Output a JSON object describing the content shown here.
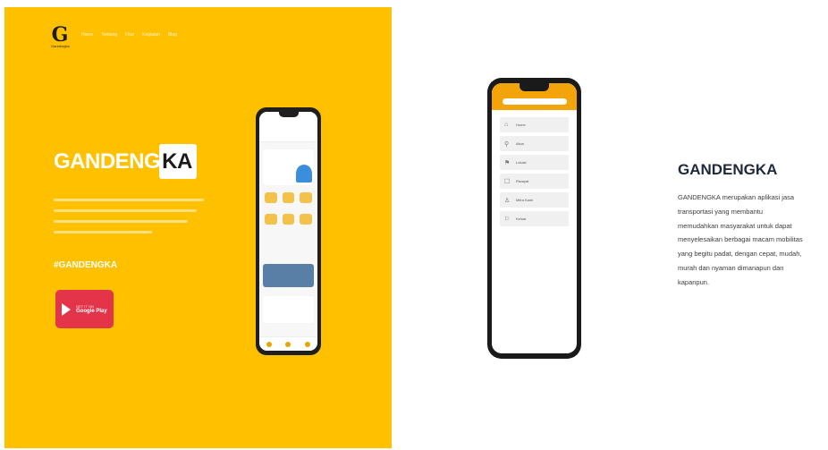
{
  "hero": {
    "logo_letter": "G",
    "logo_sub": "Gandengka",
    "nav": [
      "Home",
      "Tentang",
      "Fitur",
      "Kegiatan",
      "Blog"
    ],
    "brand_part1": "GANDENG",
    "brand_part2": "KA",
    "hashtag": "#GANDENGKA",
    "play_small": "GET IT ON",
    "play_big": "Google Play",
    "colors": {
      "background": "#ffc000",
      "button": "#e3344a"
    }
  },
  "phone_menu": {
    "items": [
      {
        "icon": "home-icon",
        "glyph": "⌂",
        "label": "Home"
      },
      {
        "icon": "user-icon",
        "glyph": "⚲",
        "label": "Akun"
      },
      {
        "icon": "location-icon",
        "glyph": "⚑",
        "label": "Lokasi"
      },
      {
        "icon": "document-icon",
        "glyph": "☐",
        "label": "Riwayat"
      },
      {
        "icon": "person-icon",
        "glyph": "♙",
        "label": "Mitra Kami"
      },
      {
        "icon": "flag-icon",
        "glyph": "⚐",
        "label": "Keluar"
      }
    ],
    "colors": {
      "header": "#f4a40b"
    }
  },
  "info": {
    "title": "GANDENGKA",
    "lines": [
      "GANDENGKA merupakan aplikasi jasa",
      "transportasi yang membantu",
      "memudahkan masyarakat untuk dapat",
      "menyelesaikan berbagai macam mobilitas",
      "yang begitu padat, dengan cepat, mudah,",
      "murah dan nyaman dimanapun dan",
      "kapanpun."
    ]
  }
}
